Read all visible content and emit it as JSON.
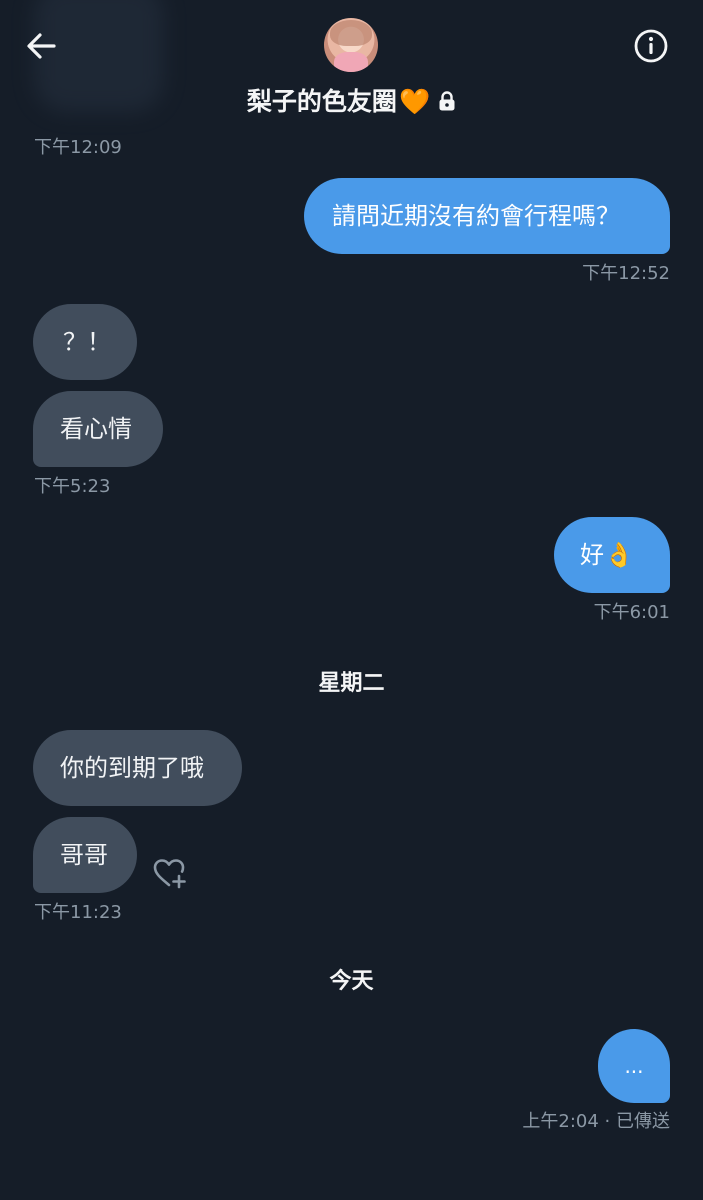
{
  "header": {
    "title": "梨子的色友圈",
    "title_heart": "🧡",
    "icons": {
      "back": "back-arrow-icon",
      "info": "info-icon",
      "lock": "lock-icon"
    }
  },
  "messages": [
    {
      "id": "m0_time",
      "timestamp": "下午12:09"
    },
    {
      "id": "m1",
      "direction": "outgoing",
      "text": "請問近期沒有約會行程嗎？",
      "timestamp": "下午12:52"
    },
    {
      "id": "m2",
      "direction": "incoming",
      "text": "？！"
    },
    {
      "id": "m3",
      "direction": "incoming",
      "text": "看心情",
      "timestamp": "下午5:23"
    },
    {
      "id": "m4",
      "direction": "outgoing",
      "text": "好👌",
      "timestamp": "下午6:01"
    },
    {
      "id": "sep1",
      "type": "day-separator",
      "text": "星期二"
    },
    {
      "id": "m5",
      "direction": "incoming",
      "text": "你的到期了哦"
    },
    {
      "id": "m6",
      "direction": "incoming",
      "text": "哥哥",
      "timestamp": "下午11:23"
    },
    {
      "id": "sep2",
      "type": "day-separator",
      "text": "今天"
    },
    {
      "id": "m7",
      "direction": "outgoing",
      "text": "...",
      "timestamp": "上午2:04 · 已傳送"
    }
  ],
  "colors": {
    "background": "#151d28",
    "incoming_bubble": "#414d5c",
    "outgoing_bubble": "#4a9ae9",
    "timestamp": "#8b98a5"
  }
}
